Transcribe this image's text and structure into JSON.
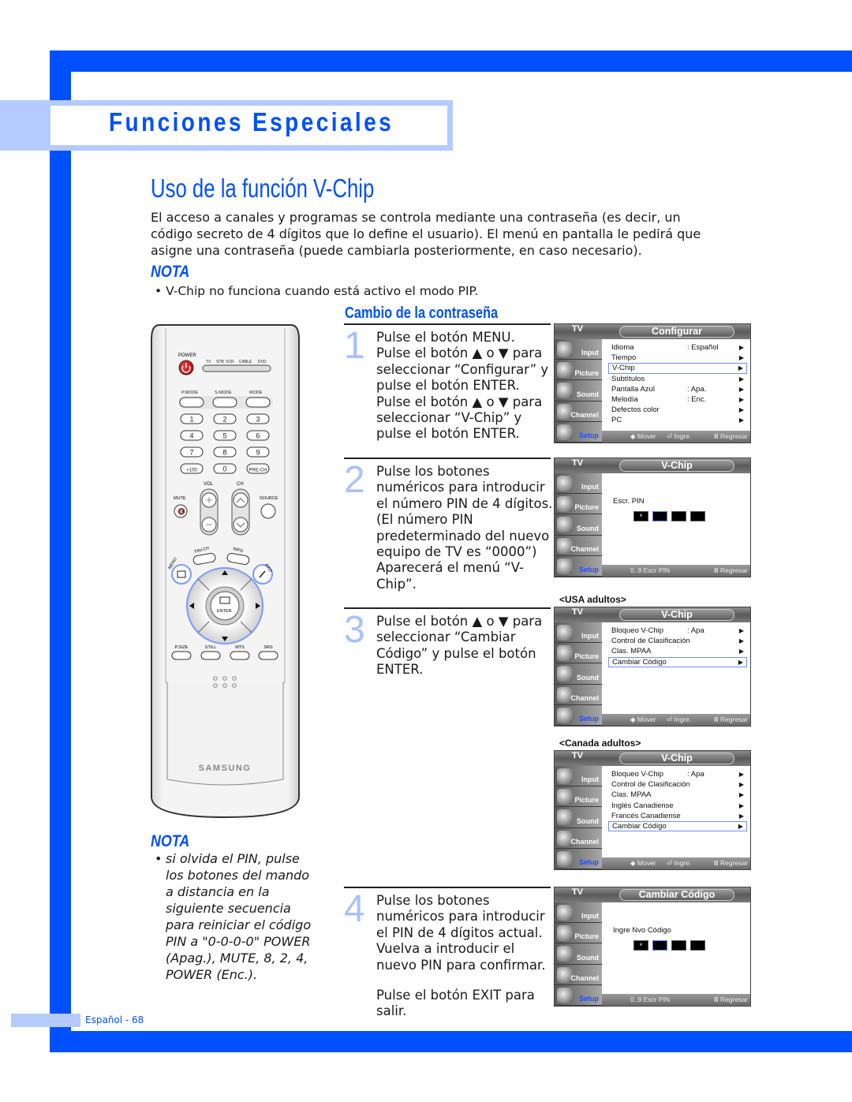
{
  "section": {
    "title": "Funciones Especiales"
  },
  "page": {
    "title": "Uso de la función V-Chip",
    "intro": "El acceso a canales y programas se controla mediante una contraseña (es decir, un código secreto de 4 dígitos que lo define el usuario). El menú en pantalla le pedirá que asigne una contraseña (puede cambiarla posteriormente, en caso necesario).",
    "nota_label": "NOTA",
    "nota_text": "• V-Chip no funciona cuando está activo el modo PIP.",
    "subsection_title": "Cambio de la contraseña"
  },
  "remote": {
    "power_label": "POWER",
    "source_labels": [
      "TV",
      "STB",
      "VCR",
      "CABLE",
      "DVD"
    ],
    "mode_labels": [
      "P.MODE",
      "S.MODE",
      "MODE"
    ],
    "digits": [
      "1",
      "2",
      "3",
      "4",
      "5",
      "6",
      "7",
      "8",
      "9",
      "+100",
      "0",
      "PRE-CH"
    ],
    "vol_label": "VOL",
    "ch_label": "CH",
    "mute_label": "MUTE",
    "source_label": "SOURCE",
    "fav_label": "FAV.CH",
    "info_label": "INFO",
    "menu_label": "MENU",
    "exit_label": "EXIT",
    "enter_label": "ENTER",
    "bottom_labels": [
      "P.SIZE",
      "STILL",
      "MTS",
      "SRS"
    ],
    "brand": "SAMSUNG"
  },
  "steps": [
    {
      "num": "1",
      "lines": [
        "Pulse el botón MENU.",
        "Pulse el botón ▲ o ▼ para seleccionar “Configurar” y pulse el botón ENTER.",
        "Pulse el botón ▲ o ▼ para seleccionar “V-Chip” y pulse el botón ENTER."
      ]
    },
    {
      "num": "2",
      "lines": [
        "Pulse los botones numéricos para introducir el número PIN de 4 dígitos.",
        "(El número PIN predeterminado del nuevo equipo de TV es “0000”) Aparecerá el menú “V-Chip”."
      ]
    },
    {
      "num": "3",
      "lines": [
        "Pulse el botón ▲ o ▼ para seleccionar “Cambiar Código” y pulse el botón ENTER."
      ]
    },
    {
      "num": "4",
      "lines": [
        "Pulse los botones numéricos para introducir el PIN de 4 dígitos actual.",
        "Vuelva a introducir el nuevo PIN para confirmar."
      ],
      "extra": "Pulse el botón EXIT para salir."
    }
  ],
  "osd_common": {
    "tv_label": "TV",
    "side_items": [
      "Input",
      "Picture",
      "Sound",
      "Channel",
      "Setup"
    ],
    "footer_move": "◆ Mover",
    "footer_enter": "⏎ Ingre.",
    "footer_back": "Ⅲ Regresar",
    "footer_pin": "0..9 Escr PIN"
  },
  "osd_screens": [
    {
      "caption": "",
      "title": "Configurar",
      "type": "menu",
      "rows": [
        {
          "label": "Idioma",
          "value": ": Español",
          "selected": false
        },
        {
          "label": "Tiempo",
          "value": "",
          "selected": false
        },
        {
          "label": "V-Chip",
          "value": "",
          "selected": true
        },
        {
          "label": "Subtítulos",
          "value": "",
          "selected": false
        },
        {
          "label": "Pantalla Azul",
          "value": ": Apa.",
          "selected": false
        },
        {
          "label": "Melodía",
          "value": ": Enc.",
          "selected": false
        },
        {
          "label": "Defectos color",
          "value": "",
          "selected": false
        },
        {
          "label": "PC",
          "value": "",
          "selected": false
        }
      ]
    },
    {
      "caption": "",
      "title": "V-Chip",
      "type": "pin",
      "pin_label": "Escr. PIN",
      "pin_entered": "*"
    },
    {
      "caption": "<USA adultos>",
      "title": "V-Chip",
      "type": "menu",
      "rows": [
        {
          "label": "Bloqueo V-Chip",
          "value": ": Apa",
          "selected": false
        },
        {
          "label": "Control de Clasificación",
          "value": "",
          "selected": false
        },
        {
          "label": "Clas. MPAA",
          "value": "",
          "selected": false
        },
        {
          "label": "Cambiar Código",
          "value": "",
          "selected": true
        }
      ]
    },
    {
      "caption": "<Canada adultos>",
      "title": "V-Chip",
      "type": "menu",
      "rows": [
        {
          "label": "Bloqueo V-Chip",
          "value": ": Apa",
          "selected": false
        },
        {
          "label": "Control de Clasificación",
          "value": "",
          "selected": false
        },
        {
          "label": "Clas. MPAA",
          "value": "",
          "selected": false
        },
        {
          "label": "Inglés Canadiense",
          "value": "",
          "selected": false
        },
        {
          "label": "Francés Canadiense",
          "value": "",
          "selected": false
        },
        {
          "label": "Cambiar Código",
          "value": "",
          "selected": true
        }
      ]
    },
    {
      "caption": "",
      "title": "Cambiar Código",
      "type": "pin",
      "pin_label": "Ingre Nvo Código",
      "pin_entered": "*"
    }
  ],
  "nota_bottom": {
    "label": "NOTA",
    "bullet": "•",
    "text": "si olvida el PIN, pulse los botones del mando a distancia en la siguiente secuencia para reiniciar el código PIN a \"0-0-0-0\" POWER (Apag.), MUTE, 8, 2, 4, POWER (Enc.)."
  },
  "footer": {
    "page_label": "Español - 68"
  },
  "colors": {
    "brand_blue": "#0050ff",
    "light_blue": "#b5cbff",
    "step_number": "#a9c1ff",
    "power_red": "#e0141e"
  }
}
